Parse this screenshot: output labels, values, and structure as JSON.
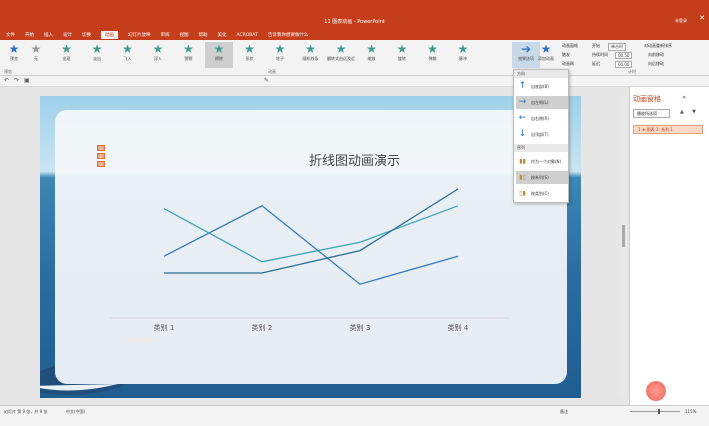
{
  "window": {
    "title": "11 图表动画 - PowerPoint",
    "user": "未登录"
  },
  "menu": [
    "文件",
    "开始",
    "插入",
    "设计",
    "切换",
    "动画",
    "幻灯片放映",
    "审阅",
    "视图",
    "帮助",
    "美化",
    "ACROBAT",
    "告诉我你想要做什么"
  ],
  "active_menu_index": 5,
  "ribbon": {
    "preview": "预览",
    "animations": [
      "无",
      "出现",
      "淡出",
      "飞入",
      "浮入",
      "劈裂",
      "擦除",
      "形状",
      "轮子",
      "随机线条",
      "翻转式由远及近",
      "缩放",
      "旋转",
      "弹跳",
      "脉冲"
    ],
    "selected_animation_index": 6,
    "effect_options": "效果选项",
    "add_animation": "添加动画",
    "animation_pane_btn": "动画窗格",
    "trigger": "触发",
    "animation_painter": "动画刷",
    "start_label": "开始",
    "start_value": "单击时",
    "duration_label": "持续时间",
    "duration_value": "00.50",
    "delay_label": "延迟",
    "delay_value": "00.00",
    "reorder_label": "对动画重新排序",
    "move_earlier": "向前移动",
    "move_later": "向后移动",
    "groups": {
      "preview": "预览",
      "animation": "动画",
      "timing": "计时"
    }
  },
  "dropdown": {
    "direction_header": "方向",
    "items": [
      {
        "icon": "arrow-up",
        "label": "自底部(B)"
      },
      {
        "icon": "arrow-right",
        "label": "自左侧(L)"
      },
      {
        "icon": "arrow-left",
        "label": "自右侧(R)"
      },
      {
        "icon": "arrow-down",
        "label": "自顶部(T)"
      }
    ],
    "selected_index": 1,
    "sequence_header": "序列",
    "sequence_items": [
      {
        "label": "作为一个对象(N)"
      },
      {
        "label": "按系列(S)"
      },
      {
        "label": "按类别(C)"
      }
    ],
    "sequence_selected_index": 1
  },
  "slide": {
    "title": "折线图动画演示",
    "number_markers": [
      "1",
      "2",
      "3"
    ]
  },
  "chart_data": {
    "type": "line",
    "categories": [
      "类别 1",
      "类别 2",
      "类别 3",
      "类别 4"
    ],
    "series": [
      {
        "values": [
          2.1,
          3.9,
          1.1,
          2.1
        ],
        "color": "#3a78b8"
      },
      {
        "values": [
          3.8,
          1.9,
          2.6,
          3.9
        ],
        "color": "#3fa3b5"
      },
      {
        "values": [
          1.5,
          1.5,
          2.3,
          4.5
        ],
        "color": "#2c6d96"
      }
    ],
    "ylim": [
      0,
      5
    ],
    "grid": false
  },
  "pane": {
    "title": "动画窗格",
    "play": "播放所选项",
    "item": "1 ★ 图表 3: 系列 1"
  },
  "status": {
    "slide": "幻灯片 第 9 张，共 9 张",
    "lang": "中文(中国)",
    "notes": "备注",
    "zoom": "115%"
  }
}
